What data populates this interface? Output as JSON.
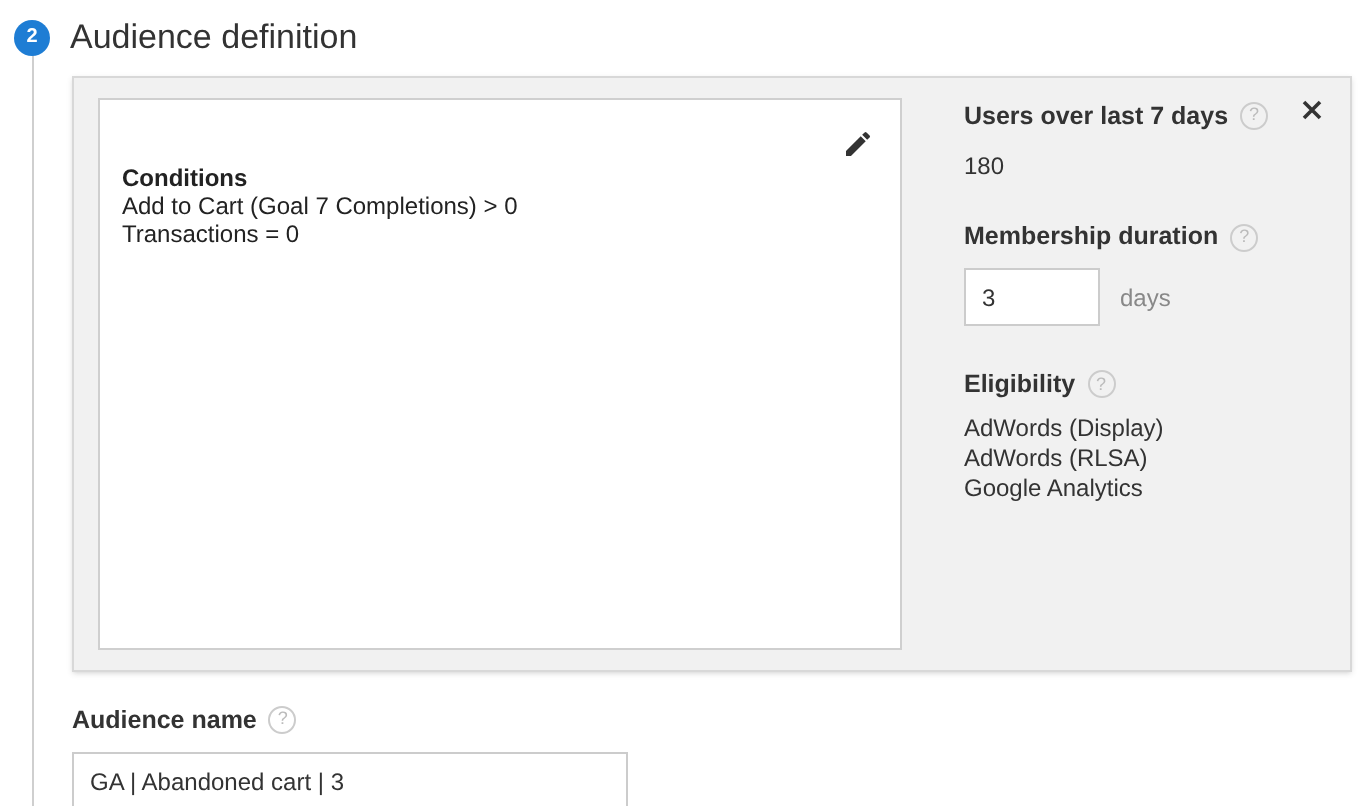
{
  "step": {
    "number": "2",
    "title": "Audience definition"
  },
  "conditions": {
    "heading": "Conditions",
    "lines": [
      "Add to Cart (Goal 7 Completions) > 0",
      "Transactions = 0"
    ]
  },
  "users": {
    "label": "Users over last 7 days",
    "help": "?",
    "value": "180"
  },
  "membership": {
    "label": "Membership duration",
    "help": "?",
    "value": "3",
    "unit": "days"
  },
  "eligibility": {
    "label": "Eligibility",
    "help": "?",
    "items": [
      "AdWords (Display)",
      "AdWords (RLSA)",
      "Google Analytics"
    ]
  },
  "audience_name": {
    "label": "Audience name",
    "help": "?",
    "value": "GA | Abandoned cart | 3"
  }
}
